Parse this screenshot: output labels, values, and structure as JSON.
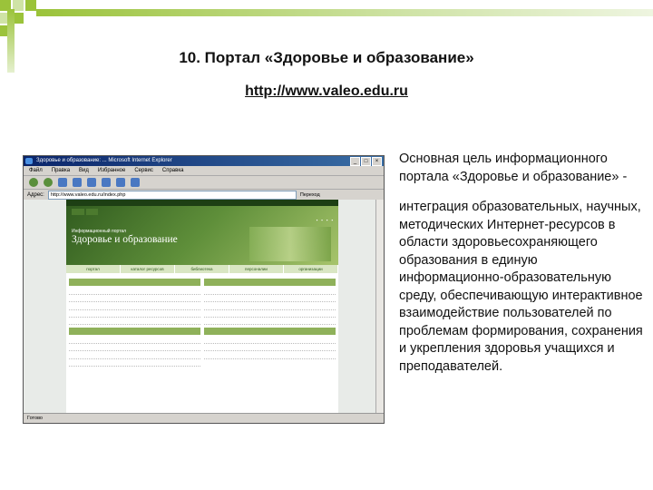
{
  "slide": {
    "title": "10. Портал «Здоровье и образование»",
    "url": "http://www.valeo.edu.ru",
    "description_lead": "Основная цель информационного портала «Здоровье и образование» -",
    "description_body": "интеграция образовательных, научных, методических Интернет-ресурсов в области здоровьесохраняющего образования в единую информационно-образовательную среду, обеспечивающую интерактивное взаимодействие пользователей по проблемам формирования, сохранения и укрепления здоровья учащихся и преподавателей."
  },
  "colors": {
    "accent": "#9bc33a",
    "site_green": "#5f8f3a"
  },
  "browser": {
    "title": "Здоровье и образование: ... Microsoft Internet Explorer",
    "menu": [
      "Файл",
      "Правка",
      "Вид",
      "Избранное",
      "Сервис",
      "Справка"
    ],
    "address_label": "Адрес:",
    "address": "http://www.valeo.edu.ru/index.php",
    "go_label": "Переход",
    "status": "Готово"
  },
  "site": {
    "logo_small": "Информационный портал",
    "logo_big": "Здоровье и образование",
    "nav": [
      "портал",
      "каталог ресурсов",
      "библиотека",
      "персоналии",
      "организации"
    ]
  }
}
